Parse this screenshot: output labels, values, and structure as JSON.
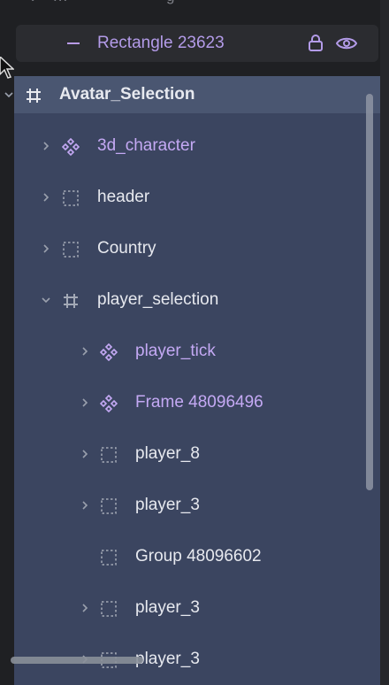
{
  "top_row": {
    "label_start": "...",
    "label_end": "g"
  },
  "rectangle_row": {
    "label": "Rectangle 23623"
  },
  "tree": [
    {
      "id": "avatar-selection",
      "label": "Avatar_Selection",
      "kind": "frame",
      "depth": 0,
      "color": "white",
      "bold": true,
      "expanded": true
    },
    {
      "id": "3d-character",
      "label": "3d_character",
      "kind": "component",
      "depth": 1,
      "color": "purple"
    },
    {
      "id": "header",
      "label": "header",
      "kind": "group",
      "depth": 1,
      "color": "white"
    },
    {
      "id": "country",
      "label": "Country",
      "kind": "group",
      "depth": 1,
      "color": "white"
    },
    {
      "id": "player-selection",
      "label": "player_selection",
      "kind": "frame",
      "depth": 1,
      "color": "white",
      "expanded": true
    },
    {
      "id": "player-tick",
      "label": "player_tick",
      "kind": "component",
      "depth": 2,
      "color": "purple"
    },
    {
      "id": "frame-48096496",
      "label": "Frame 48096496",
      "kind": "component",
      "depth": 2,
      "color": "purple"
    },
    {
      "id": "player-8",
      "label": "player_8",
      "kind": "group",
      "depth": 2,
      "color": "white"
    },
    {
      "id": "player-3a",
      "label": "player_3",
      "kind": "group",
      "depth": 2,
      "color": "white"
    },
    {
      "id": "group-48096602",
      "label": "Group 48096602",
      "kind": "group",
      "depth": 2,
      "color": "white",
      "no_chevron": true
    },
    {
      "id": "player-3b",
      "label": "player_3",
      "kind": "group",
      "depth": 2,
      "color": "white"
    },
    {
      "id": "player-3c",
      "label": "player_3",
      "kind": "group",
      "depth": 2,
      "color": "white"
    }
  ],
  "colors": {
    "panel_bg": "#1f2023",
    "selected_bg": "#3b4560",
    "selected_header_bg": "#4a5671",
    "purple_text": "#c4a9f4",
    "white_text": "#e7e9ef"
  }
}
